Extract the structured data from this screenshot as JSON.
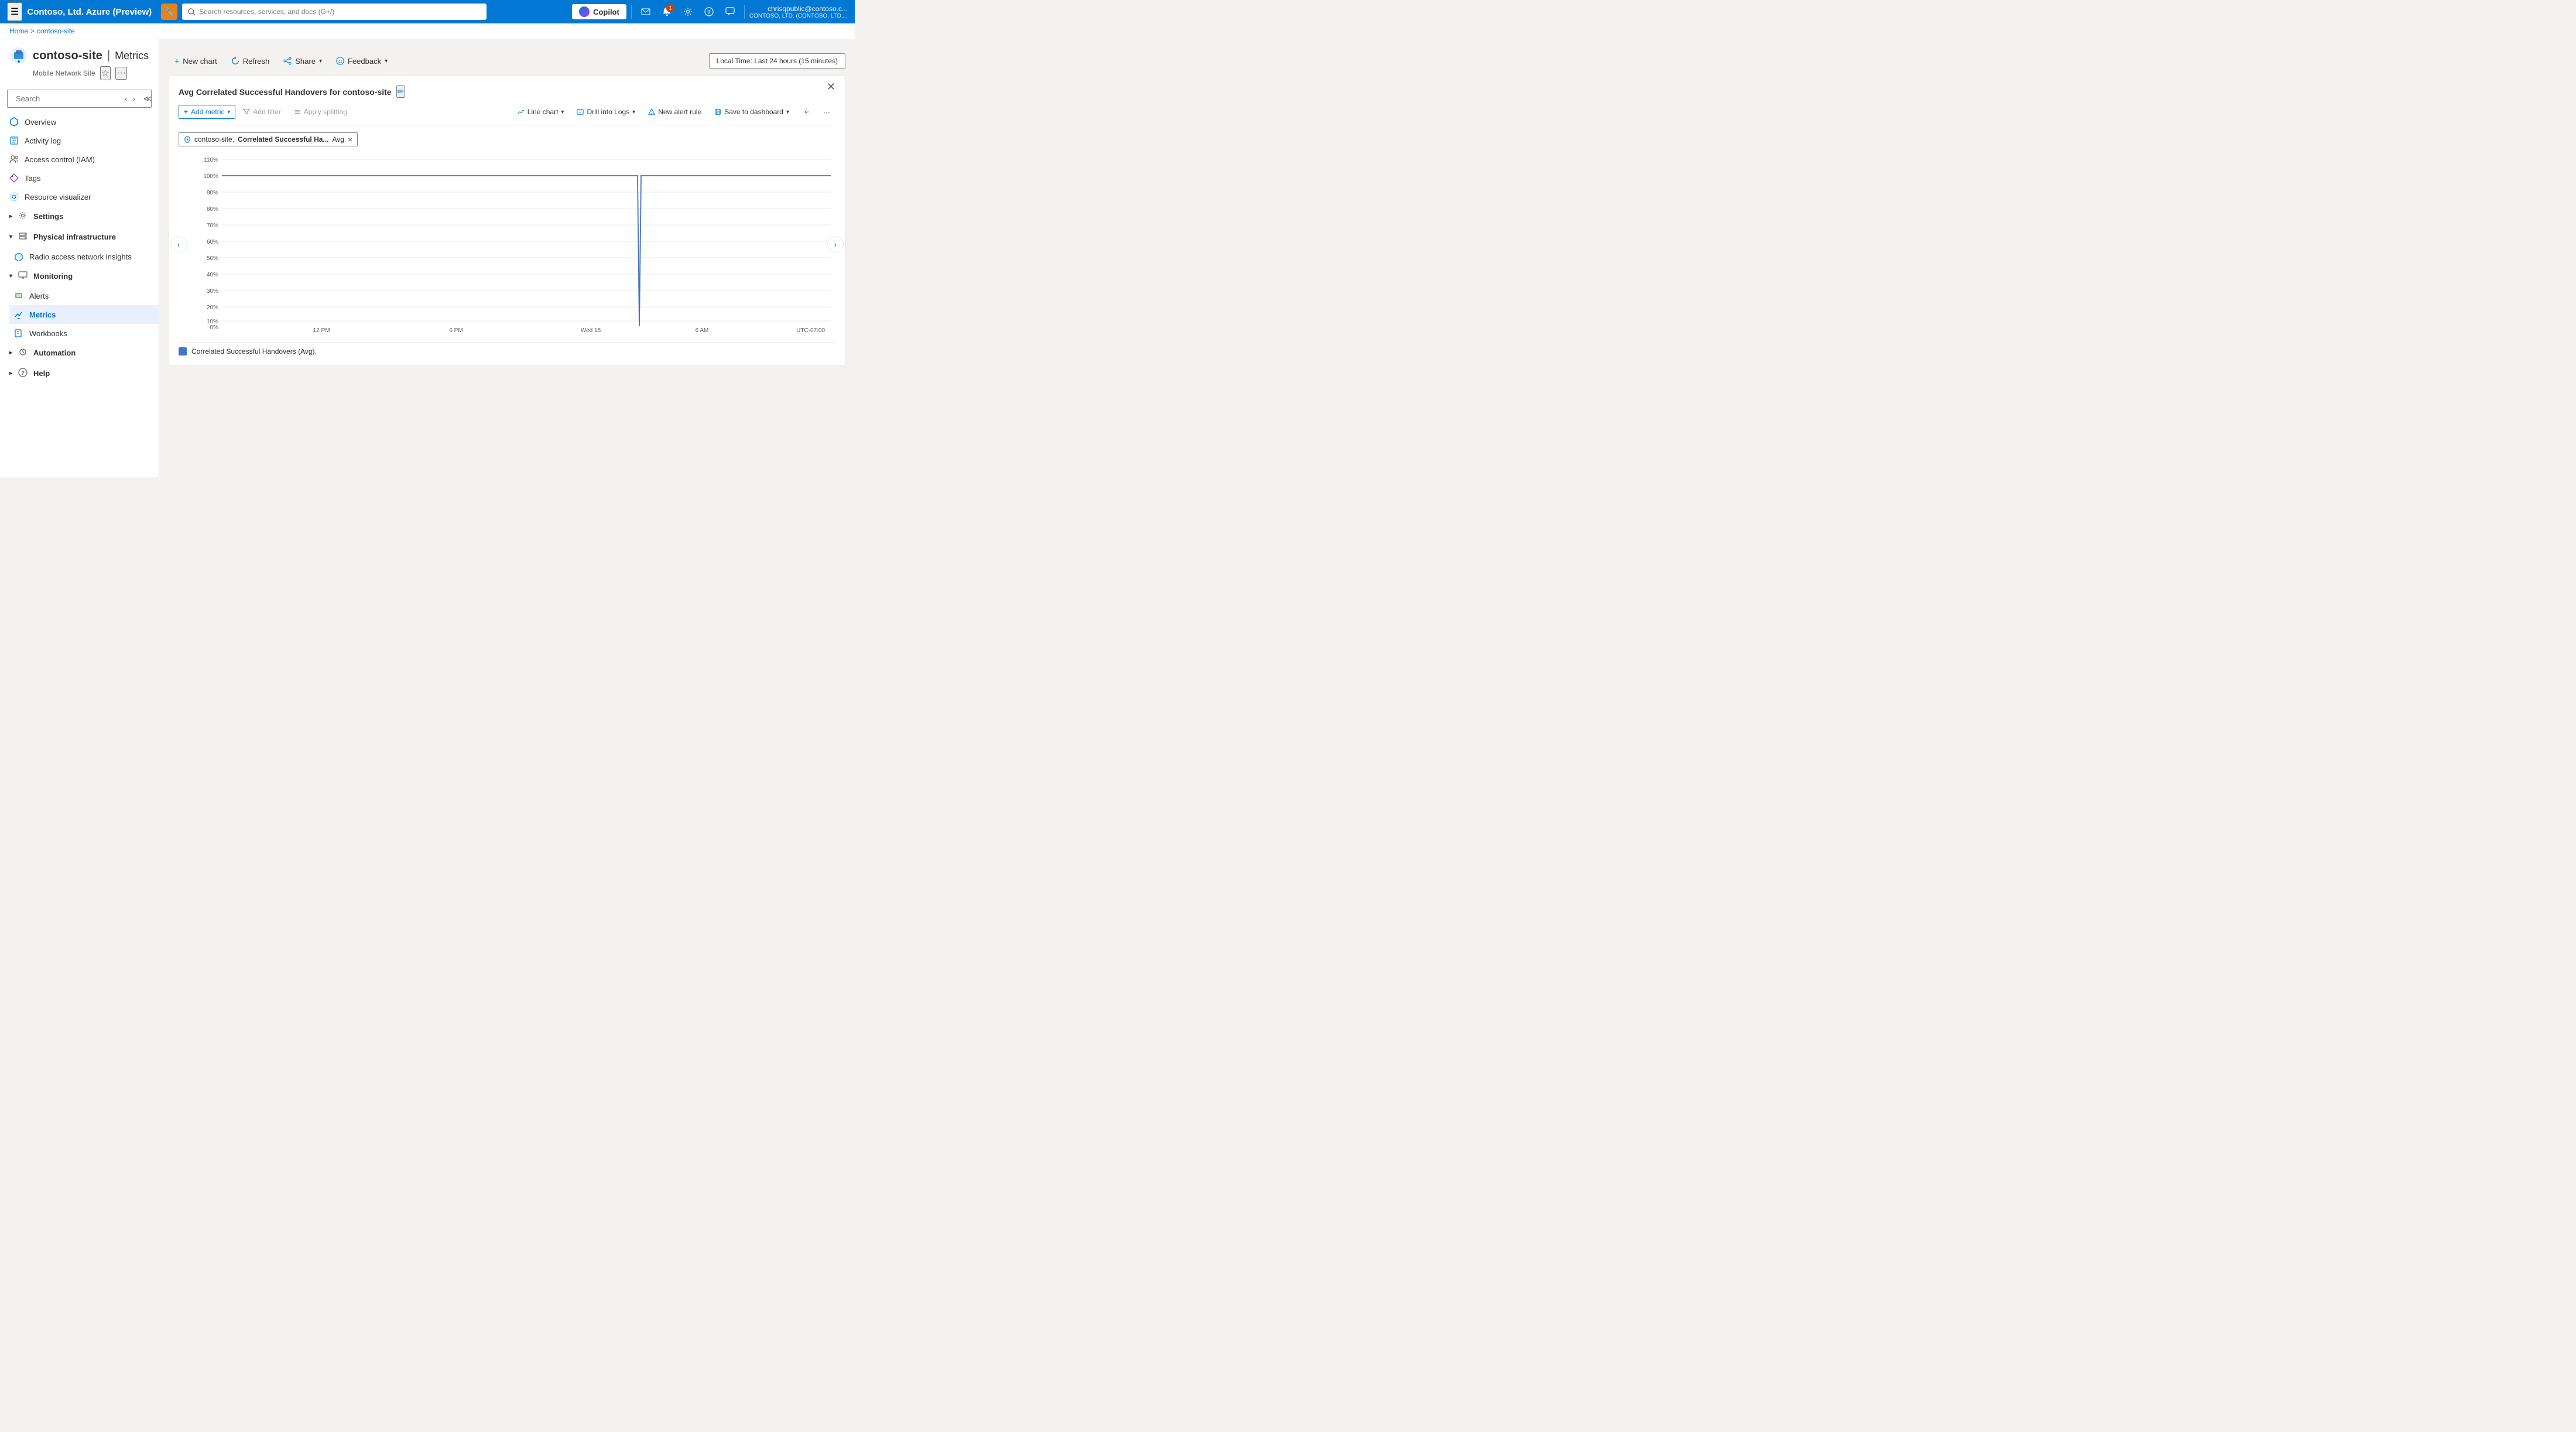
{
  "topbar": {
    "hamburger": "☰",
    "title": "Contoso, Ltd. Azure (Preview)",
    "icon_emoji": "🔧",
    "search_placeholder": "Search resources, services, and docs (G+/)",
    "copilot_label": "Copilot",
    "bell_badge": "1",
    "user_name": "chrisqpublic@contoso.c...",
    "user_tenant": "CONTOSO, LTD. (CONTOSO, LTD...."
  },
  "breadcrumb": {
    "home": "Home",
    "separator": ">",
    "current": "contoso-site"
  },
  "resource": {
    "name": "contoso-site",
    "page": "Metrics",
    "subtitle": "Mobile Network Site"
  },
  "toolbar": {
    "new_chart": "New chart",
    "refresh": "Refresh",
    "share": "Share",
    "feedback": "Feedback",
    "time_range": "Local Time: Last 24 hours (15 minutes)"
  },
  "chart": {
    "title": "Avg Correlated Successful Handovers for contoso-site",
    "add_metric": "Add metric",
    "add_filter": "Add filter",
    "apply_splitting": "Apply splitting",
    "chart_type": "Line chart",
    "drill_logs": "Drill into Logs",
    "new_alert": "New alert rule",
    "save_dashboard": "Save to dashboard",
    "metric_tag": {
      "resource": "contoso-site,",
      "metric": "Correlated Successful Ha...",
      "aggregation": "Avg"
    },
    "y_axis": [
      "110%",
      "100%",
      "90%",
      "80%",
      "70%",
      "60%",
      "50%",
      "40%",
      "30%",
      "20%",
      "10%",
      "0%"
    ],
    "x_axis": [
      "12 PM",
      "6 PM",
      "Wed 15",
      "",
      "6 AM",
      "UTC-07:00"
    ],
    "legend_label": "Correlated Successful Handovers (Avg).",
    "legend_color": "#4472c4"
  },
  "sidebar": {
    "search_placeholder": "Search",
    "nav_items": [
      {
        "id": "overview",
        "label": "Overview",
        "icon": "overview"
      },
      {
        "id": "activity-log",
        "label": "Activity log",
        "icon": "activity"
      },
      {
        "id": "iam",
        "label": "Access control (IAM)",
        "icon": "iam"
      },
      {
        "id": "tags",
        "label": "Tags",
        "icon": "tags"
      },
      {
        "id": "resource-visualizer",
        "label": "Resource visualizer",
        "icon": "visualizer"
      },
      {
        "id": "settings",
        "label": "Settings",
        "icon": "settings",
        "expandable": true
      },
      {
        "id": "physical-infrastructure",
        "label": "Physical infrastructure",
        "icon": "physical",
        "expandable": true,
        "expanded": true
      },
      {
        "id": "radio-access",
        "label": "Radio access network insights",
        "icon": "radio",
        "child": true
      },
      {
        "id": "monitoring",
        "label": "Monitoring",
        "icon": "monitoring",
        "expandable": true,
        "expanded": true
      },
      {
        "id": "alerts",
        "label": "Alerts",
        "icon": "alerts",
        "child": true
      },
      {
        "id": "metrics",
        "label": "Metrics",
        "icon": "metrics",
        "child": true,
        "active": true
      },
      {
        "id": "workbooks",
        "label": "Workbooks",
        "icon": "workbooks",
        "child": true
      },
      {
        "id": "automation",
        "label": "Automation",
        "icon": "automation",
        "expandable": true
      },
      {
        "id": "help",
        "label": "Help",
        "icon": "help",
        "expandable": true
      }
    ]
  }
}
